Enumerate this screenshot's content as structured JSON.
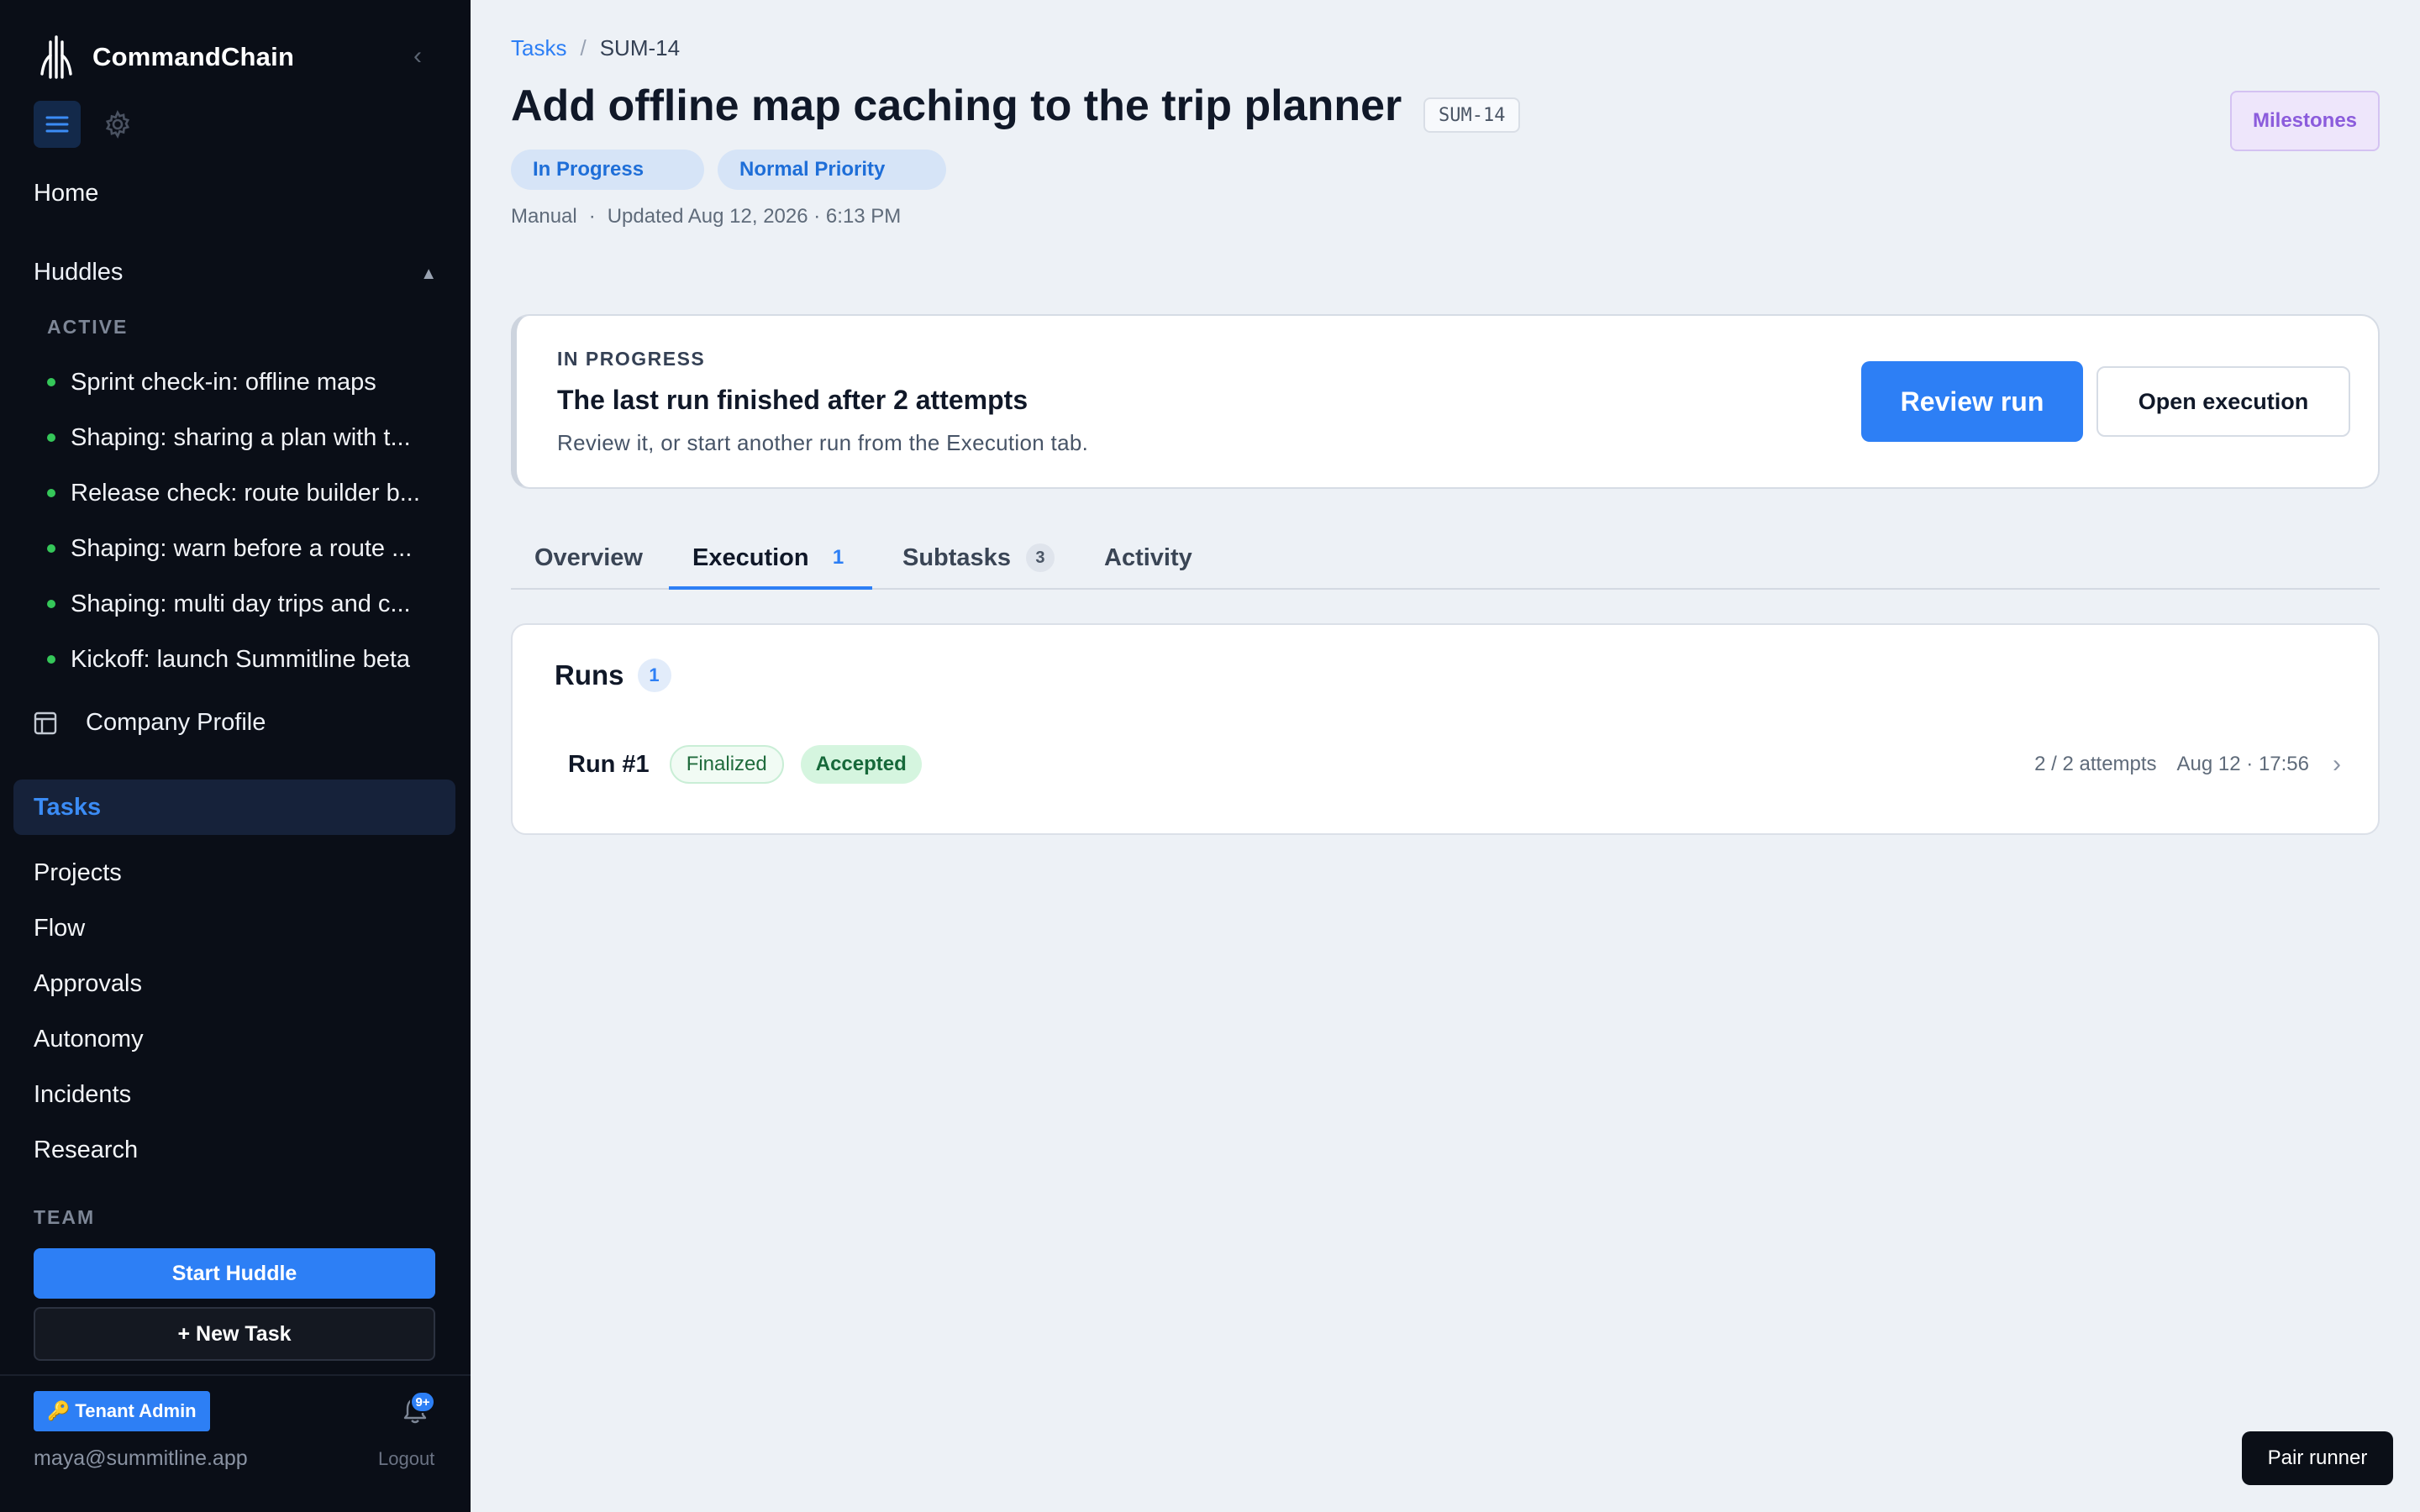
{
  "app": {
    "name": "CommandChain"
  },
  "sidebar": {
    "home_label": "Home",
    "huddles_label": "Huddles",
    "active_section": "ACTIVE",
    "huddles": [
      {
        "label": "Sprint check-in: offline maps"
      },
      {
        "label": "Shaping: sharing a plan with t..."
      },
      {
        "label": "Release check: route builder b..."
      },
      {
        "label": "Shaping: warn before a route ..."
      },
      {
        "label": "Shaping: multi day trips and c..."
      },
      {
        "label": "Kickoff: launch Summitline beta"
      }
    ],
    "company_label": "Company Profile",
    "tasks_label": "Tasks",
    "nav": [
      {
        "label": "Projects"
      },
      {
        "label": "Flow"
      },
      {
        "label": "Approvals"
      },
      {
        "label": "Autonomy"
      },
      {
        "label": "Incidents"
      },
      {
        "label": "Research"
      }
    ],
    "team_section": "TEAM",
    "start_huddle": "Start Huddle",
    "new_task": "+ New Task",
    "tenant_badge": "Tenant Admin",
    "notifications_badge": "9+",
    "user_email": "maya@summitline.app",
    "logout": "Logout"
  },
  "breadcrumb": {
    "parent": "Tasks",
    "separator": "/",
    "current": "SUM-14"
  },
  "task": {
    "title": "Add offline map caching to the trip planner",
    "id": "SUM-14",
    "status": "In Progress",
    "priority": "Normal Priority",
    "source": "Manual",
    "meta_sep": "·",
    "updated": "Updated Aug 12, 2026 · 6:13 PM"
  },
  "header": {
    "milestones": "Milestones"
  },
  "banner": {
    "eyebrow": "IN PROGRESS",
    "title": "The last run finished after 2 attempts",
    "subtitle": "Review it, or start another run from the Execution tab.",
    "primary": "Review run",
    "secondary": "Open execution"
  },
  "tabs": [
    {
      "label": "Overview",
      "count": ""
    },
    {
      "label": "Execution",
      "count": "1"
    },
    {
      "label": "Subtasks",
      "count": "3"
    },
    {
      "label": "Activity",
      "count": ""
    }
  ],
  "runs": {
    "title": "Runs",
    "count": "1",
    "items": [
      {
        "name": "Run #1",
        "state": "Finalized",
        "result": "Accepted",
        "attempts": "2 / 2 attempts",
        "time": "Aug 12 · 17:56"
      }
    ]
  },
  "pair_runner": "Pair runner",
  "colors": {
    "sidebar_bg": "#0a0e17",
    "accent": "#2d7ff5",
    "page_bg": "#edf1f6",
    "success": "#35c759",
    "milestones": "#8b5cdc"
  },
  "icons": [
    "app-logo-icon",
    "chevron-left-icon",
    "menu-icon",
    "gear-icon",
    "caret-up-icon",
    "layout-icon",
    "key-icon",
    "bell-icon",
    "chevron-right-icon"
  ]
}
